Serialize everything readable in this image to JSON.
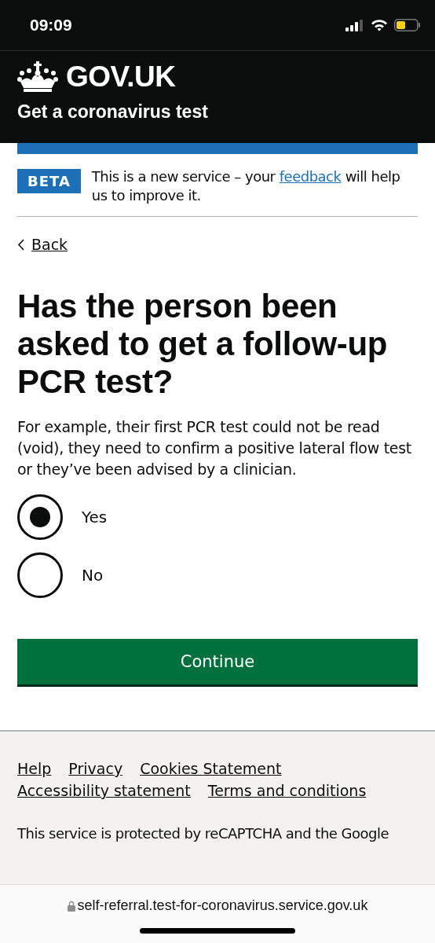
{
  "status_bar": {
    "time": "09:09"
  },
  "header": {
    "logo": "GOV.UK",
    "service_name": "Get a coronavirus test"
  },
  "phase_banner": {
    "tag": "BETA",
    "text_before": "This is a new service – your",
    "link": "feedback",
    "text_after": "will help us to improve it."
  },
  "back_link": "Back",
  "question": {
    "heading": "Has the person been asked to get a follow-up PCR test?",
    "hint": "For example, their first PCR test could not be read (void), they need to confirm a positive lateral flow test or they’ve been advised by a clinician.",
    "options": [
      {
        "label": "Yes",
        "selected": true
      },
      {
        "label": "No",
        "selected": false
      }
    ]
  },
  "continue_button": "Continue",
  "footer": {
    "links": [
      {
        "label": "Help"
      },
      {
        "label": "Privacy"
      },
      {
        "label": "Cookies Statement"
      },
      {
        "label": "Accessibility statement"
      },
      {
        "label": "Terms and conditions"
      }
    ],
    "notice": "This service is protected by reCAPTCHA and the Google"
  },
  "address_bar": {
    "url": "self-referral.test-for-coronavirus.service.gov.uk"
  }
}
